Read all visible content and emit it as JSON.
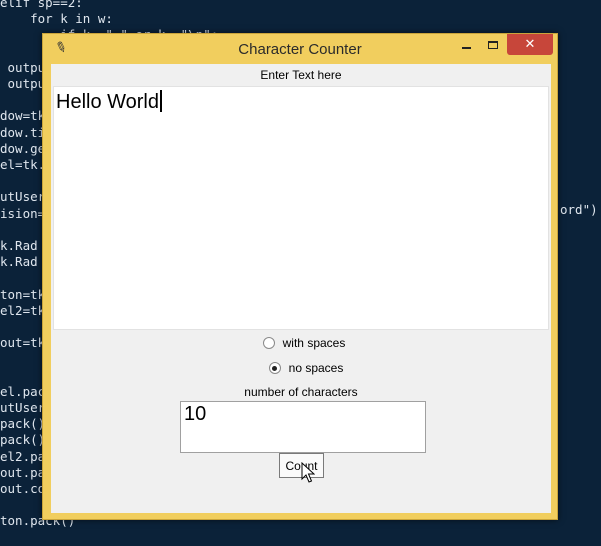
{
  "window": {
    "title": "Character Counter",
    "close_glyph": "✕"
  },
  "form": {
    "input_label": "Enter Text here",
    "input_value": "Hello World",
    "radio_options": [
      {
        "label": "with spaces",
        "checked": false
      },
      {
        "label": "no spaces",
        "checked": true
      }
    ],
    "result_label": "number of characters",
    "result_value": "10",
    "count_button_label": "Count"
  },
  "background_code": {
    "lines": [
      "elif sp==2:",
      "    for k in w:",
      "        if k==\" \" or k==\"\\n\":",
      "",
      " outpu",
      " outpu",
      "",
      "dow=tk",
      "dow.ti",
      "dow.ge",
      "el=tk.",
      "",
      "utUser",
      "ision=",
      "",
      "k.Rad",
      "k.Rad",
      "",
      "ton=tk",
      "el2=tk",
      "",
      "out=tk",
      "",
      "",
      "el.pac",
      "utUser",
      "pack()",
      "pack()",
      "el2.pa",
      "out.pa",
      "out.co",
      "",
      "ton.pack()"
    ],
    "right_fragment": "ord\")"
  },
  "colors": {
    "desktop_bg": "#0b2239",
    "window_frame": "#f1ce5e",
    "close_button": "#c7463a",
    "client_bg": "#f0f0f0"
  },
  "icons": {
    "app": "feather-icon",
    "minimize": "minimize-icon",
    "maximize": "maximize-icon",
    "close": "close-icon",
    "cursor": "mouse-pointer-icon"
  }
}
